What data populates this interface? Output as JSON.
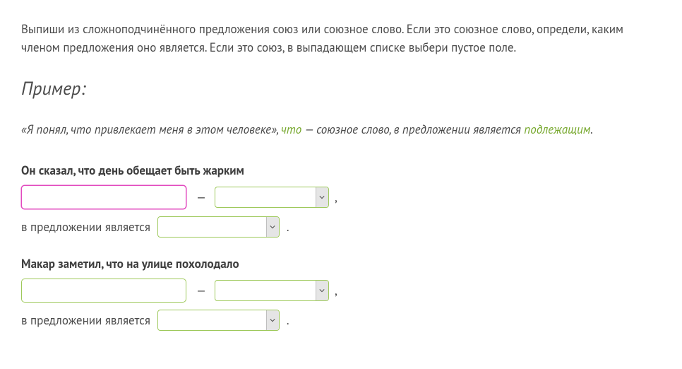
{
  "instructions": "Выпиши из сложноподчинённого предложения союз или союзное слово. Если это союзное слово, определи, каким членом предложения оно является. Если это союз, в выпадающем списке выбери пустое поле.",
  "example": {
    "heading": "Пример:",
    "prefix": "«Я понял, что привлекает меня в этом человеке», ",
    "highlighted_word": "что",
    "mid": " — союзное слово, в предложении является ",
    "role_word": "подлежащим",
    "suffix": "."
  },
  "labels": {
    "dash": "—",
    "comma": ",",
    "period": ".",
    "role_prefix": "в предложении является"
  },
  "tasks": [
    {
      "sentence": "Он сказал, что день обещает быть жарким",
      "input_value": "",
      "input_focused": true,
      "select_type_value": "",
      "select_role_value": ""
    },
    {
      "sentence": "Макар заметил, что на улице похолодало",
      "input_value": "",
      "input_focused": false,
      "select_type_value": "",
      "select_role_value": ""
    }
  ]
}
